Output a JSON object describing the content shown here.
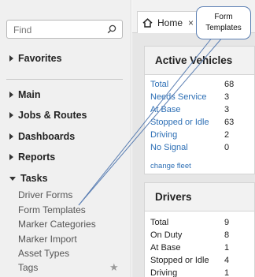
{
  "sidebar": {
    "search_placeholder": "Find",
    "sections": [
      "Favorites",
      "Main",
      "Jobs & Routes",
      "Dashboards",
      "Reports",
      "Tasks"
    ],
    "tasks_items": [
      "Driver Forms",
      "Form Templates",
      "Marker Categories",
      "Marker Import",
      "Asset Types",
      "Tags"
    ]
  },
  "tabs": {
    "home_label": "Home",
    "close_glyph": "×"
  },
  "active_vehicles": {
    "title": "Active Vehicles",
    "rows": [
      {
        "label": "Total",
        "value": "68"
      },
      {
        "label": "Needs Service",
        "value": "3"
      },
      {
        "label": "At Base",
        "value": "3"
      },
      {
        "label": "Stopped or Idle",
        "value": "63"
      },
      {
        "label": "Driving",
        "value": "2"
      },
      {
        "label": "No Signal",
        "value": "0"
      }
    ],
    "link": "change fleet"
  },
  "drivers": {
    "title": "Drivers",
    "rows": [
      {
        "label": "Total",
        "value": "9"
      },
      {
        "label": "On Duty",
        "value": "8"
      },
      {
        "label": "At Base",
        "value": "1"
      },
      {
        "label": "Stopped or Idle",
        "value": "4"
      },
      {
        "label": "Driving",
        "value": "1"
      }
    ]
  },
  "callout": {
    "line1": "Form",
    "line2": "Templates"
  },
  "colors": {
    "link_blue": "#2d6fb5",
    "sidebar_bg": "#f0f0f0",
    "callout_border": "#5b7fb3"
  },
  "icons": {
    "search": "search-icon",
    "home": "home-icon",
    "star": "star-icon"
  }
}
